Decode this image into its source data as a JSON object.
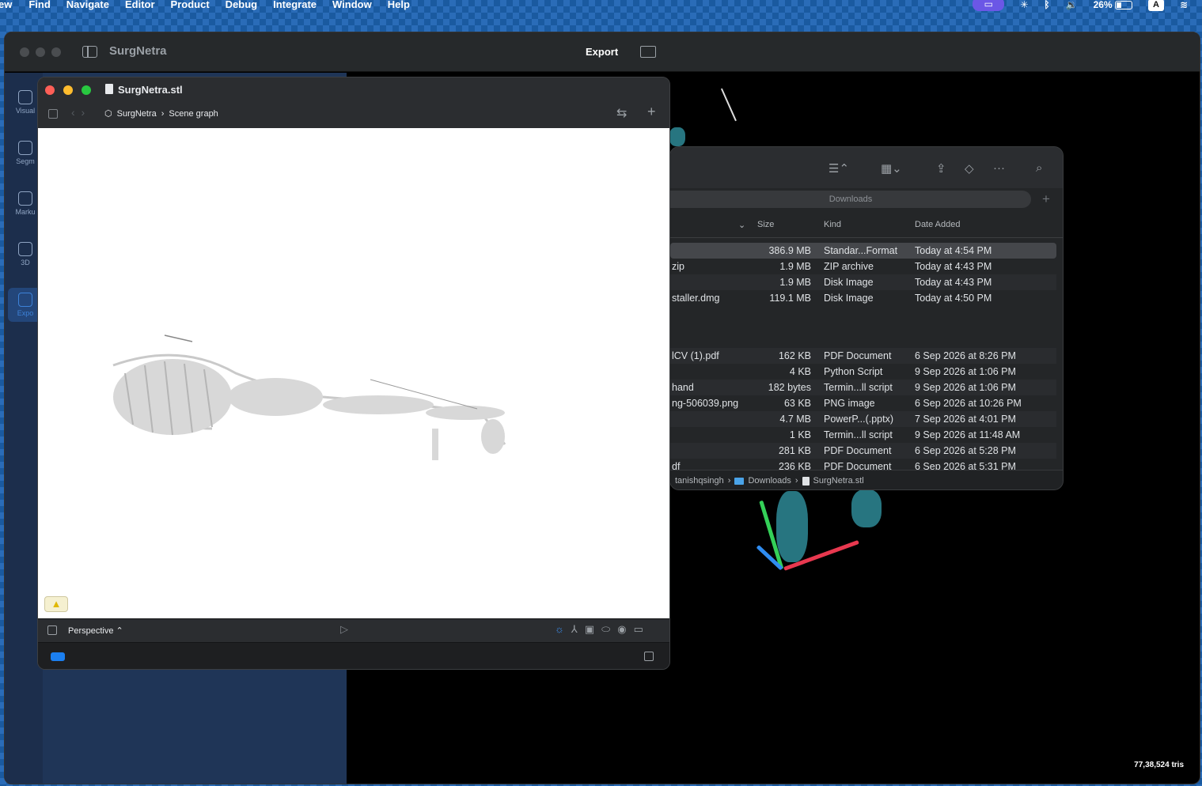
{
  "menubar": {
    "items": [
      "ew",
      "Find",
      "Navigate",
      "Editor",
      "Product",
      "Debug",
      "Integrate",
      "Window",
      "Help"
    ],
    "battery": "26%",
    "input_source": "A"
  },
  "app": {
    "title": "SurgNetra",
    "export_label": "Export",
    "rail": [
      {
        "label": "Visual"
      },
      {
        "label": "Segm"
      },
      {
        "label": "Marku"
      },
      {
        "label": "3D"
      },
      {
        "label": "Expo"
      }
    ],
    "tris": "77,38,524 tris"
  },
  "scene": {
    "title": "SurgNetra.stl",
    "breadcrumb": [
      "SurgNetra",
      "Scene graph"
    ],
    "perspective": "Perspective"
  },
  "finder": {
    "path_field": "Downloads",
    "columns": {
      "size": "Size",
      "kind": "Kind",
      "date": "Date Added"
    },
    "rows": [
      {
        "name": "",
        "size": "386.9 MB",
        "kind": "Standar...Format",
        "date": "Today at 4:54 PM"
      },
      {
        "name": "zip",
        "size": "1.9 MB",
        "kind": "ZIP archive",
        "date": "Today at 4:43 PM"
      },
      {
        "name": "",
        "size": "1.9 MB",
        "kind": "Disk Image",
        "date": "Today at 4:43 PM"
      },
      {
        "name": "staller.dmg",
        "size": "119.1 MB",
        "kind": "Disk Image",
        "date": "Today at 4:50 PM"
      },
      {
        "name": "lCV (1).pdf",
        "size": "162 KB",
        "kind": "PDF Document",
        "date": "6 Sep 2026 at 8:26 PM"
      },
      {
        "name": "",
        "size": "4 KB",
        "kind": "Python Script",
        "date": "9 Sep 2026 at 1:06 PM"
      },
      {
        "name": "hand",
        "size": "182 bytes",
        "kind": "Termin...ll script",
        "date": "9 Sep 2026 at 1:06 PM"
      },
      {
        "name": "ng-506039.png",
        "size": "63 KB",
        "kind": "PNG image",
        "date": "6 Sep 2026 at 10:26 PM"
      },
      {
        "name": "",
        "size": "4.7 MB",
        "kind": "PowerP...(.pptx)",
        "date": "7 Sep 2026 at 4:01 PM"
      },
      {
        "name": "",
        "size": "1 KB",
        "kind": "Termin...ll script",
        "date": "9 Sep 2026 at 11:48 AM"
      },
      {
        "name": "",
        "size": "281 KB",
        "kind": "PDF Document",
        "date": "6 Sep 2026 at 5:28 PM"
      },
      {
        "name": "df",
        "size": "236 KB",
        "kind": "PDF Document",
        "date": "6 Sep 2026 at 5:31 PM"
      }
    ],
    "path": [
      "tanishqsingh",
      "Downloads",
      "SurgNetra.stl"
    ]
  },
  "colors": {
    "accent": "#1b7ff0",
    "rail_bg": "#1c2e4c",
    "panel_bg": "#1f3557"
  }
}
